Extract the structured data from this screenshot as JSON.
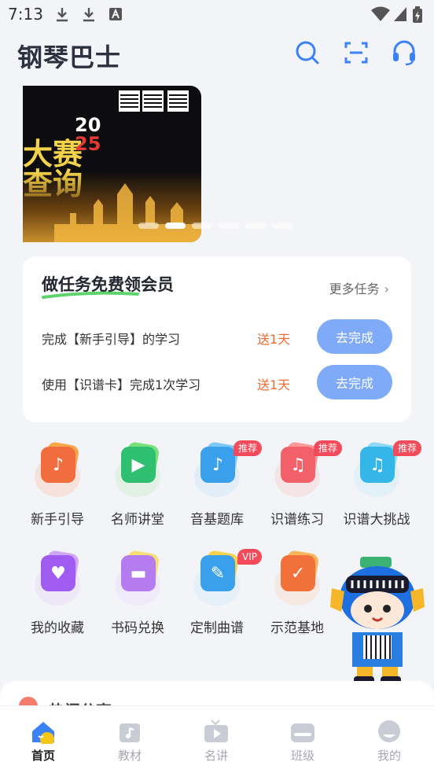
{
  "status_bar": {
    "time": "7:13"
  },
  "header": {
    "app_title": "钢琴巴士"
  },
  "banner": {
    "big_text_1": "大赛",
    "big_text_2": "查询",
    "year_top": "20",
    "year_bottom": "25",
    "slide_count": 6,
    "active_slide": 2
  },
  "task_card": {
    "title": "做任务免费领会员",
    "more_label": "更多任务",
    "tasks": [
      {
        "label": "完成【新手引导】的学习",
        "reward": "送1天",
        "button": "去完成"
      },
      {
        "label": "使用【识谱卡】完成1次学习",
        "reward": "送1天",
        "button": "去完成"
      }
    ]
  },
  "features": [
    {
      "label": "新手引导",
      "icon": "music-note-icon",
      "badge": ""
    },
    {
      "label": "名师讲堂",
      "icon": "tv-play-icon",
      "badge": ""
    },
    {
      "label": "音基题库",
      "icon": "note-book-icon",
      "badge": "推荐"
    },
    {
      "label": "识谱练习",
      "icon": "sheet-music-icon",
      "badge": "推荐"
    },
    {
      "label": "识谱大挑战",
      "icon": "challenge-notes-icon",
      "badge": "推荐"
    },
    {
      "label": "我的收藏",
      "icon": "heart-icon",
      "badge": ""
    },
    {
      "label": "书码兑换",
      "icon": "book-code-icon",
      "badge": ""
    },
    {
      "label": "定制曲谱",
      "icon": "custom-score-icon",
      "badge": "VIP"
    },
    {
      "label": "示范基地",
      "icon": "check-base-icon",
      "badge": ""
    }
  ],
  "sheet": {
    "peek_title": "热门分享"
  },
  "bottom_nav": {
    "items": [
      {
        "label": "首页",
        "icon": "home-icon",
        "active": true
      },
      {
        "label": "教材",
        "icon": "textbook-icon",
        "active": false
      },
      {
        "label": "名讲",
        "icon": "lecture-icon",
        "active": false
      },
      {
        "label": "班级",
        "icon": "class-icon",
        "active": false
      },
      {
        "label": "我的",
        "icon": "profile-icon",
        "active": false
      }
    ]
  },
  "colors": {
    "accent": "#7faaf7",
    "reward": "#f06a2d",
    "badge": "#f34b5b",
    "banner_gold": "#f4d24b"
  }
}
